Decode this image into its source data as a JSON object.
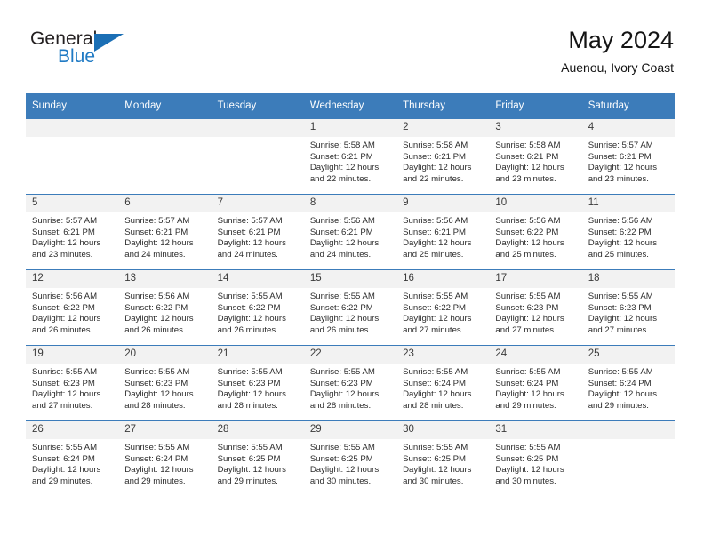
{
  "brand": {
    "word_one": "General",
    "word_two": "Blue",
    "flag_icon": "triangle-flag-icon",
    "accent_color": "#1b6fb5"
  },
  "header": {
    "title": "May 2024",
    "subtitle": "Auenou, Ivory Coast"
  },
  "calendar": {
    "header_bg": "#3c7cba",
    "daynum_bg": "#f2f2f2",
    "weekday_headers": [
      "Sunday",
      "Monday",
      "Tuesday",
      "Wednesday",
      "Thursday",
      "Friday",
      "Saturday"
    ],
    "weeks": [
      [
        {
          "day": "",
          "sunrise": "",
          "sunset": "",
          "daylight_1": "",
          "daylight_2": ""
        },
        {
          "day": "",
          "sunrise": "",
          "sunset": "",
          "daylight_1": "",
          "daylight_2": ""
        },
        {
          "day": "",
          "sunrise": "",
          "sunset": "",
          "daylight_1": "",
          "daylight_2": ""
        },
        {
          "day": "1",
          "sunrise": "Sunrise: 5:58 AM",
          "sunset": "Sunset: 6:21 PM",
          "daylight_1": "Daylight: 12 hours",
          "daylight_2": "and 22 minutes."
        },
        {
          "day": "2",
          "sunrise": "Sunrise: 5:58 AM",
          "sunset": "Sunset: 6:21 PM",
          "daylight_1": "Daylight: 12 hours",
          "daylight_2": "and 22 minutes."
        },
        {
          "day": "3",
          "sunrise": "Sunrise: 5:58 AM",
          "sunset": "Sunset: 6:21 PM",
          "daylight_1": "Daylight: 12 hours",
          "daylight_2": "and 23 minutes."
        },
        {
          "day": "4",
          "sunrise": "Sunrise: 5:57 AM",
          "sunset": "Sunset: 6:21 PM",
          "daylight_1": "Daylight: 12 hours",
          "daylight_2": "and 23 minutes."
        }
      ],
      [
        {
          "day": "5",
          "sunrise": "Sunrise: 5:57 AM",
          "sunset": "Sunset: 6:21 PM",
          "daylight_1": "Daylight: 12 hours",
          "daylight_2": "and 23 minutes."
        },
        {
          "day": "6",
          "sunrise": "Sunrise: 5:57 AM",
          "sunset": "Sunset: 6:21 PM",
          "daylight_1": "Daylight: 12 hours",
          "daylight_2": "and 24 minutes."
        },
        {
          "day": "7",
          "sunrise": "Sunrise: 5:57 AM",
          "sunset": "Sunset: 6:21 PM",
          "daylight_1": "Daylight: 12 hours",
          "daylight_2": "and 24 minutes."
        },
        {
          "day": "8",
          "sunrise": "Sunrise: 5:56 AM",
          "sunset": "Sunset: 6:21 PM",
          "daylight_1": "Daylight: 12 hours",
          "daylight_2": "and 24 minutes."
        },
        {
          "day": "9",
          "sunrise": "Sunrise: 5:56 AM",
          "sunset": "Sunset: 6:21 PM",
          "daylight_1": "Daylight: 12 hours",
          "daylight_2": "and 25 minutes."
        },
        {
          "day": "10",
          "sunrise": "Sunrise: 5:56 AM",
          "sunset": "Sunset: 6:22 PM",
          "daylight_1": "Daylight: 12 hours",
          "daylight_2": "and 25 minutes."
        },
        {
          "day": "11",
          "sunrise": "Sunrise: 5:56 AM",
          "sunset": "Sunset: 6:22 PM",
          "daylight_1": "Daylight: 12 hours",
          "daylight_2": "and 25 minutes."
        }
      ],
      [
        {
          "day": "12",
          "sunrise": "Sunrise: 5:56 AM",
          "sunset": "Sunset: 6:22 PM",
          "daylight_1": "Daylight: 12 hours",
          "daylight_2": "and 26 minutes."
        },
        {
          "day": "13",
          "sunrise": "Sunrise: 5:56 AM",
          "sunset": "Sunset: 6:22 PM",
          "daylight_1": "Daylight: 12 hours",
          "daylight_2": "and 26 minutes."
        },
        {
          "day": "14",
          "sunrise": "Sunrise: 5:55 AM",
          "sunset": "Sunset: 6:22 PM",
          "daylight_1": "Daylight: 12 hours",
          "daylight_2": "and 26 minutes."
        },
        {
          "day": "15",
          "sunrise": "Sunrise: 5:55 AM",
          "sunset": "Sunset: 6:22 PM",
          "daylight_1": "Daylight: 12 hours",
          "daylight_2": "and 26 minutes."
        },
        {
          "day": "16",
          "sunrise": "Sunrise: 5:55 AM",
          "sunset": "Sunset: 6:22 PM",
          "daylight_1": "Daylight: 12 hours",
          "daylight_2": "and 27 minutes."
        },
        {
          "day": "17",
          "sunrise": "Sunrise: 5:55 AM",
          "sunset": "Sunset: 6:23 PM",
          "daylight_1": "Daylight: 12 hours",
          "daylight_2": "and 27 minutes."
        },
        {
          "day": "18",
          "sunrise": "Sunrise: 5:55 AM",
          "sunset": "Sunset: 6:23 PM",
          "daylight_1": "Daylight: 12 hours",
          "daylight_2": "and 27 minutes."
        }
      ],
      [
        {
          "day": "19",
          "sunrise": "Sunrise: 5:55 AM",
          "sunset": "Sunset: 6:23 PM",
          "daylight_1": "Daylight: 12 hours",
          "daylight_2": "and 27 minutes."
        },
        {
          "day": "20",
          "sunrise": "Sunrise: 5:55 AM",
          "sunset": "Sunset: 6:23 PM",
          "daylight_1": "Daylight: 12 hours",
          "daylight_2": "and 28 minutes."
        },
        {
          "day": "21",
          "sunrise": "Sunrise: 5:55 AM",
          "sunset": "Sunset: 6:23 PM",
          "daylight_1": "Daylight: 12 hours",
          "daylight_2": "and 28 minutes."
        },
        {
          "day": "22",
          "sunrise": "Sunrise: 5:55 AM",
          "sunset": "Sunset: 6:23 PM",
          "daylight_1": "Daylight: 12 hours",
          "daylight_2": "and 28 minutes."
        },
        {
          "day": "23",
          "sunrise": "Sunrise: 5:55 AM",
          "sunset": "Sunset: 6:24 PM",
          "daylight_1": "Daylight: 12 hours",
          "daylight_2": "and 28 minutes."
        },
        {
          "day": "24",
          "sunrise": "Sunrise: 5:55 AM",
          "sunset": "Sunset: 6:24 PM",
          "daylight_1": "Daylight: 12 hours",
          "daylight_2": "and 29 minutes."
        },
        {
          "day": "25",
          "sunrise": "Sunrise: 5:55 AM",
          "sunset": "Sunset: 6:24 PM",
          "daylight_1": "Daylight: 12 hours",
          "daylight_2": "and 29 minutes."
        }
      ],
      [
        {
          "day": "26",
          "sunrise": "Sunrise: 5:55 AM",
          "sunset": "Sunset: 6:24 PM",
          "daylight_1": "Daylight: 12 hours",
          "daylight_2": "and 29 minutes."
        },
        {
          "day": "27",
          "sunrise": "Sunrise: 5:55 AM",
          "sunset": "Sunset: 6:24 PM",
          "daylight_1": "Daylight: 12 hours",
          "daylight_2": "and 29 minutes."
        },
        {
          "day": "28",
          "sunrise": "Sunrise: 5:55 AM",
          "sunset": "Sunset: 6:25 PM",
          "daylight_1": "Daylight: 12 hours",
          "daylight_2": "and 29 minutes."
        },
        {
          "day": "29",
          "sunrise": "Sunrise: 5:55 AM",
          "sunset": "Sunset: 6:25 PM",
          "daylight_1": "Daylight: 12 hours",
          "daylight_2": "and 30 minutes."
        },
        {
          "day": "30",
          "sunrise": "Sunrise: 5:55 AM",
          "sunset": "Sunset: 6:25 PM",
          "daylight_1": "Daylight: 12 hours",
          "daylight_2": "and 30 minutes."
        },
        {
          "day": "31",
          "sunrise": "Sunrise: 5:55 AM",
          "sunset": "Sunset: 6:25 PM",
          "daylight_1": "Daylight: 12 hours",
          "daylight_2": "and 30 minutes."
        },
        {
          "day": "",
          "sunrise": "",
          "sunset": "",
          "daylight_1": "",
          "daylight_2": ""
        }
      ]
    ]
  }
}
